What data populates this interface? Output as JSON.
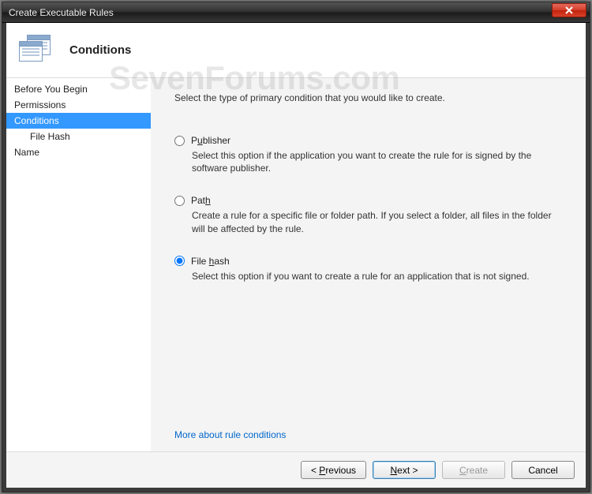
{
  "window": {
    "title": "Create Executable Rules"
  },
  "header": {
    "title": "Conditions"
  },
  "watermark": "SevenForums.com",
  "sidebar": {
    "items": [
      {
        "label": "Before You Begin"
      },
      {
        "label": "Permissions"
      },
      {
        "label": "Conditions"
      },
      {
        "label": "File Hash"
      },
      {
        "label": "Name"
      }
    ]
  },
  "main": {
    "intro": "Select the type of primary condition that you would like to create.",
    "options": {
      "publisher": {
        "label_pre": "P",
        "label_ul": "u",
        "label_post": "blisher",
        "desc": "Select this option if the application you want to create the rule for is signed by the software publisher."
      },
      "path": {
        "label_pre": "Pat",
        "label_ul": "h",
        "label_post": "",
        "desc": "Create a rule for a specific file or folder path. If you select a folder, all files in the folder will be affected by the rule."
      },
      "filehash": {
        "label_pre": "File ",
        "label_ul": "h",
        "label_post": "ash",
        "desc": "Select this option if you want to create a rule for an application that is not signed."
      }
    },
    "more_link": "More about rule conditions"
  },
  "footer": {
    "previous": {
      "pre": "< ",
      "ul": "P",
      "post": "revious"
    },
    "next": {
      "pre": "",
      "ul": "N",
      "post": "ext >"
    },
    "create": {
      "pre": "",
      "ul": "C",
      "post": "reate"
    },
    "cancel": "Cancel"
  }
}
